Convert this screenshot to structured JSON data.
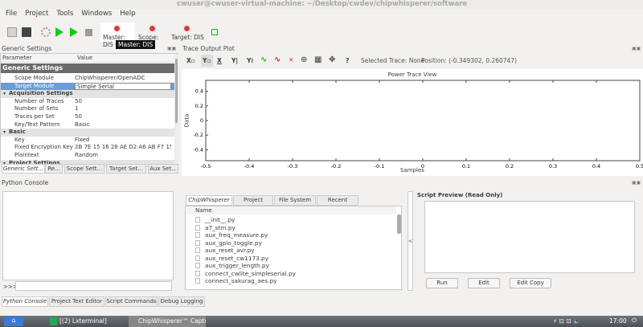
{
  "window": {
    "title": "cwuser@cwuser-virtual-machine: ~/Desktop/cwdev/chipwhisperer/software"
  },
  "menu": [
    "File",
    "Project",
    "Tools",
    "Windows",
    "Help"
  ],
  "toolbar": {
    "master": "Master: DIS",
    "scope": "Scope: DIS",
    "target": "Target: DIS",
    "status_icon": "DIS",
    "tooltip": "Master: DIS"
  },
  "generic_settings": {
    "title": "Generic Settings",
    "col_param": "Parameter",
    "col_value": "Value",
    "header": "Generic Settings",
    "rows": [
      {
        "k": "Scope Module",
        "v": "ChipWhisperer/OpenADC",
        "type": "item"
      },
      {
        "k": "Target Module",
        "v": "Simple Serial",
        "type": "select"
      },
      {
        "k": "Acquisition Settings",
        "v": "",
        "type": "group"
      },
      {
        "k": "Number of Traces",
        "v": "50",
        "type": "item"
      },
      {
        "k": "Number of Sets",
        "v": "1",
        "type": "item"
      },
      {
        "k": "Traces per Set",
        "v": "50",
        "type": "item"
      },
      {
        "k": "Key/Text Pattern",
        "v": "Basic",
        "type": "item"
      },
      {
        "k": "Basic",
        "v": "",
        "type": "group"
      },
      {
        "k": "Key",
        "v": "Fixed",
        "type": "item"
      },
      {
        "k": "Fixed Encryption Key",
        "v": "2B 7E 15 16 28 AE D2 A6 AB F7 15 88",
        "type": "item"
      },
      {
        "k": "Plaintext",
        "v": "Random",
        "type": "item"
      },
      {
        "k": "Project Settings",
        "v": "",
        "type": "group"
      }
    ],
    "tabs": [
      "Generic Sett...",
      "Re...",
      "Scope Sett...",
      "Target Set...",
      "Aux Set..."
    ]
  },
  "trace_plot": {
    "title": "Trace Output Plot",
    "selected_trace": "Selected Trace: None",
    "position": "Position: (-0.349302, 0.260747)",
    "help": "?"
  },
  "chart_data": {
    "type": "line",
    "title": "Power Trace View",
    "xlabel": "Samples",
    "ylabel": "Data",
    "xlim": [
      -0.5,
      0.5
    ],
    "ylim": [
      -0.55,
      0.55
    ],
    "xticks": [
      "-0.5",
      "-0.4",
      "-0.3",
      "-0.2",
      "-0.1",
      "0",
      "0.1",
      "0.2",
      "0.3",
      "0.4",
      "0.5"
    ],
    "yticks": [
      "0.4",
      "0.2",
      "0",
      "-0.2",
      "-0.4"
    ],
    "series": []
  },
  "python_console": {
    "title": "Python Console",
    "prompt": ">>>"
  },
  "file_browser": {
    "tabs": [
      "ChipWhisperer",
      "Project",
      "File System",
      "Recent"
    ],
    "col": "Name",
    "files": [
      "__init__.py",
      "a7_stm.py",
      "aux_freq_measure.py",
      "aux_gpio_toggle.py",
      "aux_reset_avr.py",
      "aux_reset_cw1173.py",
      "aux_trigger_length.py",
      "connect_cwlite_simpleserial.py",
      "connect_sakurag_aes.py"
    ]
  },
  "splitter": "<",
  "script_preview": {
    "title": "Script Preview (Read Only)",
    "run": "Run",
    "edit": "Edit",
    "edit_copy": "Edit Copy"
  },
  "bottom_tabs": [
    "Python Console",
    "Project Text Editor",
    "Script Commands",
    "Debug Logging"
  ],
  "taskbar": {
    "terminal": "[(2) Lxterminal]",
    "app": "ChipWhisperer™ Captu...",
    "clock": "17:00"
  }
}
